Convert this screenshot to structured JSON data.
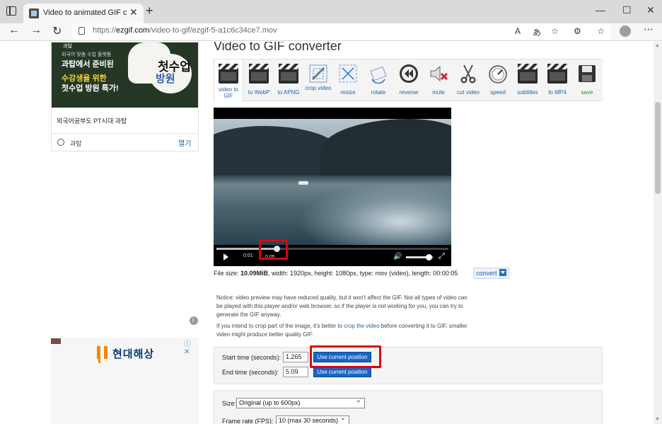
{
  "browser": {
    "tab_title": "Video to animated GIF converter",
    "tab_close": "✕",
    "new_tab": "+",
    "minimize": "—",
    "maximize": "☐",
    "close": "✕",
    "back": "←",
    "forward": "→",
    "reload": "↻",
    "url_scheme": "https://",
    "url_host": "ezgif.com",
    "url_path": "/video-to-gif/ezgif-5-a1c6c34ce7.mov",
    "read_aloud": "A",
    "translate": "あ",
    "favorite": "☆",
    "extensions": "⚙",
    "collections": "☆",
    "more": "⋯"
  },
  "ads": {
    "top": {
      "brand": "과탑",
      "line1": "외국어 맞춤 수업 플랫폼",
      "line2": "과탑에서 준비된",
      "line3": "수강생을 위한",
      "line4": "첫수업 방원 특가!",
      "headline1": "첫수업",
      "headline2": "방원",
      "caption": "외국어공부도 PT시대 과탑",
      "source": "과탑",
      "open": "열기"
    },
    "bottom": {
      "name": "현대해상",
      "choices": "ⓘ ✕"
    }
  },
  "main": {
    "title": "Video to GIF converter",
    "tools": [
      {
        "label": "video to GIF",
        "icon": "clapper-icon",
        "active": true
      },
      {
        "label": "to WebP",
        "icon": "clapper-icon"
      },
      {
        "label": "to APNG",
        "icon": "clapper-icon"
      },
      {
        "label": "crop video",
        "icon": "crop-icon"
      },
      {
        "label": "resize",
        "icon": "resize-icon"
      },
      {
        "label": "rotate",
        "icon": "rotate-icon"
      },
      {
        "label": "reverse",
        "icon": "reverse-icon"
      },
      {
        "label": "mute",
        "icon": "mute-icon"
      },
      {
        "label": "cut video",
        "icon": "scissors-icon"
      },
      {
        "label": "speed",
        "icon": "speed-icon"
      },
      {
        "label": "subtitles",
        "icon": "clapper-icon"
      },
      {
        "label": "to MP4",
        "icon": "clapper-icon"
      },
      {
        "label": "save",
        "icon": "save-icon"
      }
    ],
    "player": {
      "current_time": "0:01",
      "duration": "0:05",
      "progress": 0.26,
      "volume": 0.85
    },
    "fileinfo": {
      "prefix": "File size: ",
      "size": "10.09MiB",
      "rest": ", width: 1920px, height: 1080px, type: mov (video), length: 00:00:05",
      "convert_label": "convert"
    },
    "notice": {
      "p1": "Notice: video preview may have reduced quality, but it won't affect the GIF. Not all types of video can be played with this player and/or web browser, so if the player is not working for you, you can try to generate the GIF anyway.",
      "p2_before": "If you intend to crop part of the image, it's better to ",
      "p2_link": "crop the video",
      "p2_after": " before converting it to GIF, smaller video might produce better quality GIF."
    },
    "time": {
      "start_label": "Start time (seconds):",
      "start_value": "1.265",
      "end_label": "End time (seconds):",
      "end_value": "5.09",
      "use_current_label": "Use current position"
    },
    "options": {
      "size_label": "Size:",
      "size_value": "Original (up to 600px)",
      "fps_label": "Frame rate (FPS):",
      "fps_value": "10 (max 30 seconds)"
    }
  }
}
